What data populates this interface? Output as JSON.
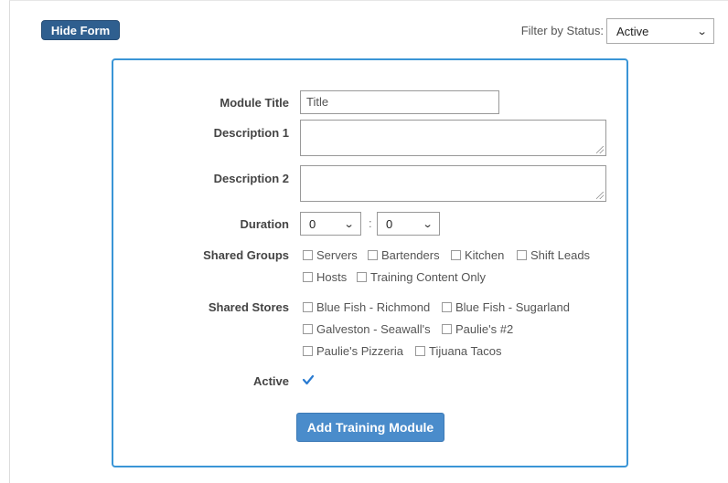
{
  "toolbar": {
    "hide_form_label": "Hide Form",
    "filter_label": "Filter by Status:",
    "filter_value": "Active"
  },
  "form": {
    "title_label": "Module Title",
    "title_value": "Title",
    "desc1_label": "Description 1",
    "desc2_label": "Description 2",
    "duration_label": "Duration",
    "duration_hours": "0",
    "duration_separator": ":",
    "duration_minutes": "0",
    "groups_label": "Shared Groups",
    "groups": [
      "Servers",
      "Bartenders",
      "Kitchen",
      "Shift Leads",
      "Hosts",
      "Training Content Only"
    ],
    "stores_label": "Shared Stores",
    "stores": [
      "Blue Fish - Richmond",
      "Blue Fish - Sugarland",
      "Galveston - Seawall's",
      "Paulie's #2",
      "Paulie's Pizzeria",
      "Tijuana Tacos"
    ],
    "active_label": "Active",
    "active_checked": true,
    "submit_label": "Add Training Module"
  },
  "colors": {
    "primary_button": "#2f5f8f",
    "submit_button": "#4a8ccb",
    "panel_border": "#3a95d6",
    "check_color": "#2a7bd1"
  },
  "icons": {
    "select_arrow": "chevron-down-icon",
    "active_check": "checkmark-icon"
  }
}
